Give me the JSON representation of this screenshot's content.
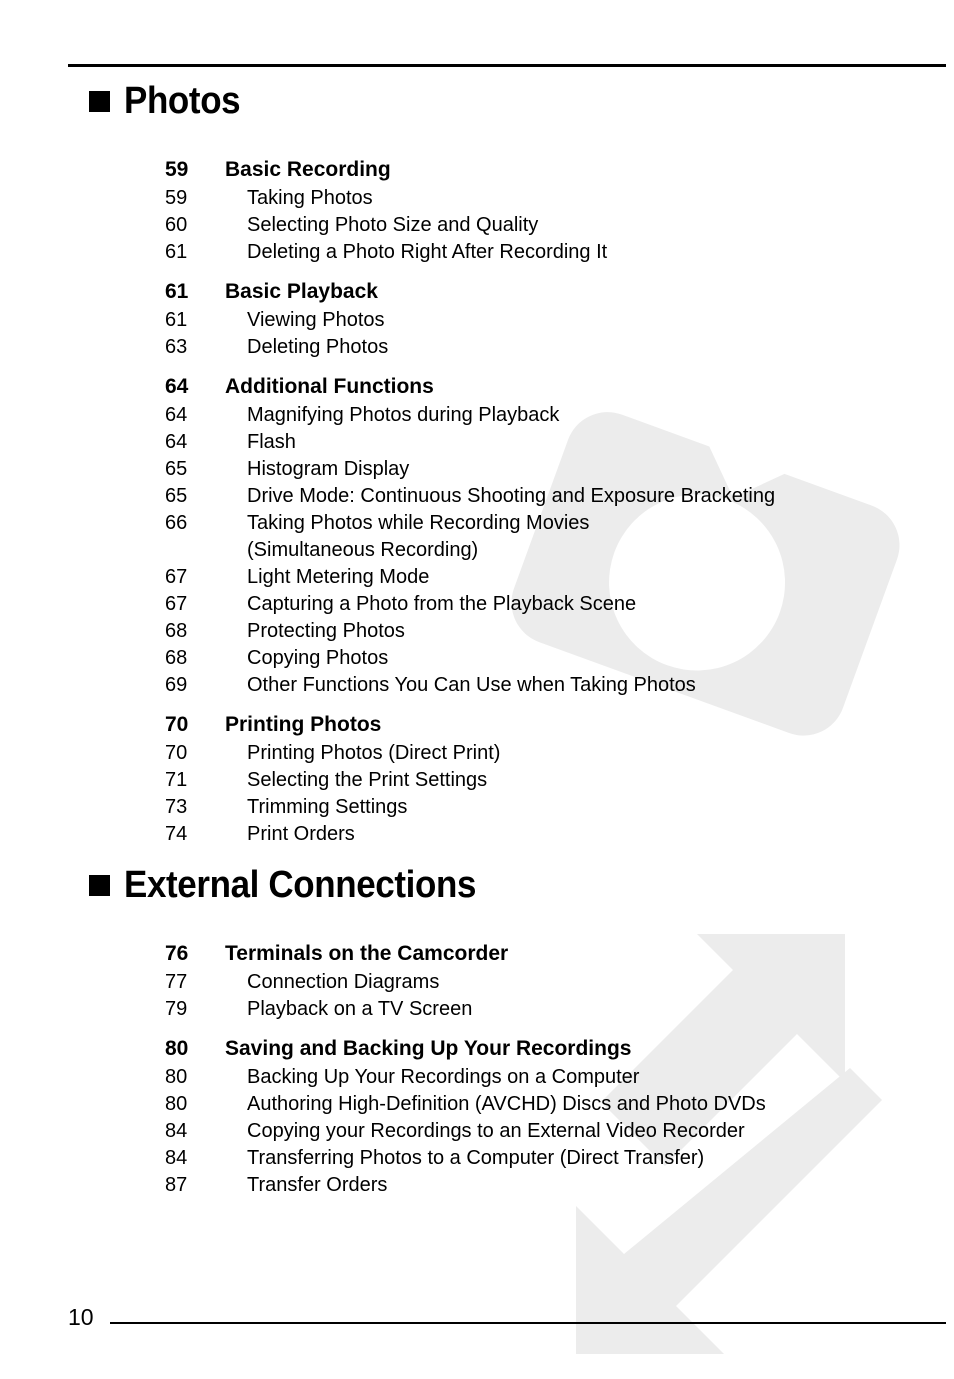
{
  "page": {
    "number": "10",
    "watermark_color": "#ECECEC"
  },
  "sections": [
    {
      "title": "Photos",
      "bullet_icon": "filled-square-bullet",
      "chapters": [
        {
          "page": "59",
          "title": "Basic Recording",
          "entries": [
            {
              "page": "59",
              "title": "Taking Photos"
            },
            {
              "page": "60",
              "title": "Selecting Photo Size and Quality"
            },
            {
              "page": "61",
              "title": "Deleting a Photo Right After Recording It"
            }
          ]
        },
        {
          "page": "61",
          "title": "Basic Playback",
          "entries": [
            {
              "page": "61",
              "title": "Viewing Photos"
            },
            {
              "page": "63",
              "title": "Deleting Photos"
            }
          ]
        },
        {
          "page": "64",
          "title": "Additional Functions",
          "entries": [
            {
              "page": "64",
              "title": "Magnifying Photos during Playback"
            },
            {
              "page": "64",
              "title": "Flash"
            },
            {
              "page": "65",
              "title": "Histogram Display"
            },
            {
              "page": "65",
              "title": "Drive Mode: Continuous Shooting and Exposure Bracketing"
            },
            {
              "page": "66",
              "title": "Taking Photos while Recording Movies"
            },
            {
              "page": "",
              "title": "(Simultaneous Recording)"
            },
            {
              "page": "67",
              "title": "Light Metering Mode"
            },
            {
              "page": "67",
              "title": "Capturing a Photo from the Playback Scene"
            },
            {
              "page": "68",
              "title": "Protecting Photos"
            },
            {
              "page": "68",
              "title": "Copying Photos"
            },
            {
              "page": "69",
              "title": "Other Functions You Can Use when Taking Photos"
            }
          ]
        },
        {
          "page": "70",
          "title": "Printing Photos",
          "entries": [
            {
              "page": "70",
              "title": "Printing Photos (Direct Print)"
            },
            {
              "page": "71",
              "title": "Selecting the Print Settings"
            },
            {
              "page": "73",
              "title": "Trimming Settings"
            },
            {
              "page": "74",
              "title": "Print Orders"
            }
          ]
        }
      ]
    },
    {
      "title": "External Connections",
      "bullet_icon": "filled-square-bullet",
      "chapters": [
        {
          "page": "76",
          "title": "Terminals on the Camcorder",
          "entries": [
            {
              "page": "77",
              "title": "Connection Diagrams"
            },
            {
              "page": "79",
              "title": "Playback on a TV Screen"
            }
          ]
        },
        {
          "page": "80",
          "title": "Saving and Backing Up Your Recordings",
          "entries": [
            {
              "page": "80",
              "title": "Backing Up Your Recordings on a Computer"
            },
            {
              "page": "80",
              "title": "Authoring High-Definition (AVCHD) Discs and Photo DVDs"
            },
            {
              "page": "84",
              "title": "Copying your Recordings to an External Video Recorder"
            },
            {
              "page": "84",
              "title": "Transferring Photos to a Computer (Direct Transfer)"
            },
            {
              "page": "87",
              "title": "Transfer Orders"
            }
          ]
        }
      ]
    }
  ]
}
